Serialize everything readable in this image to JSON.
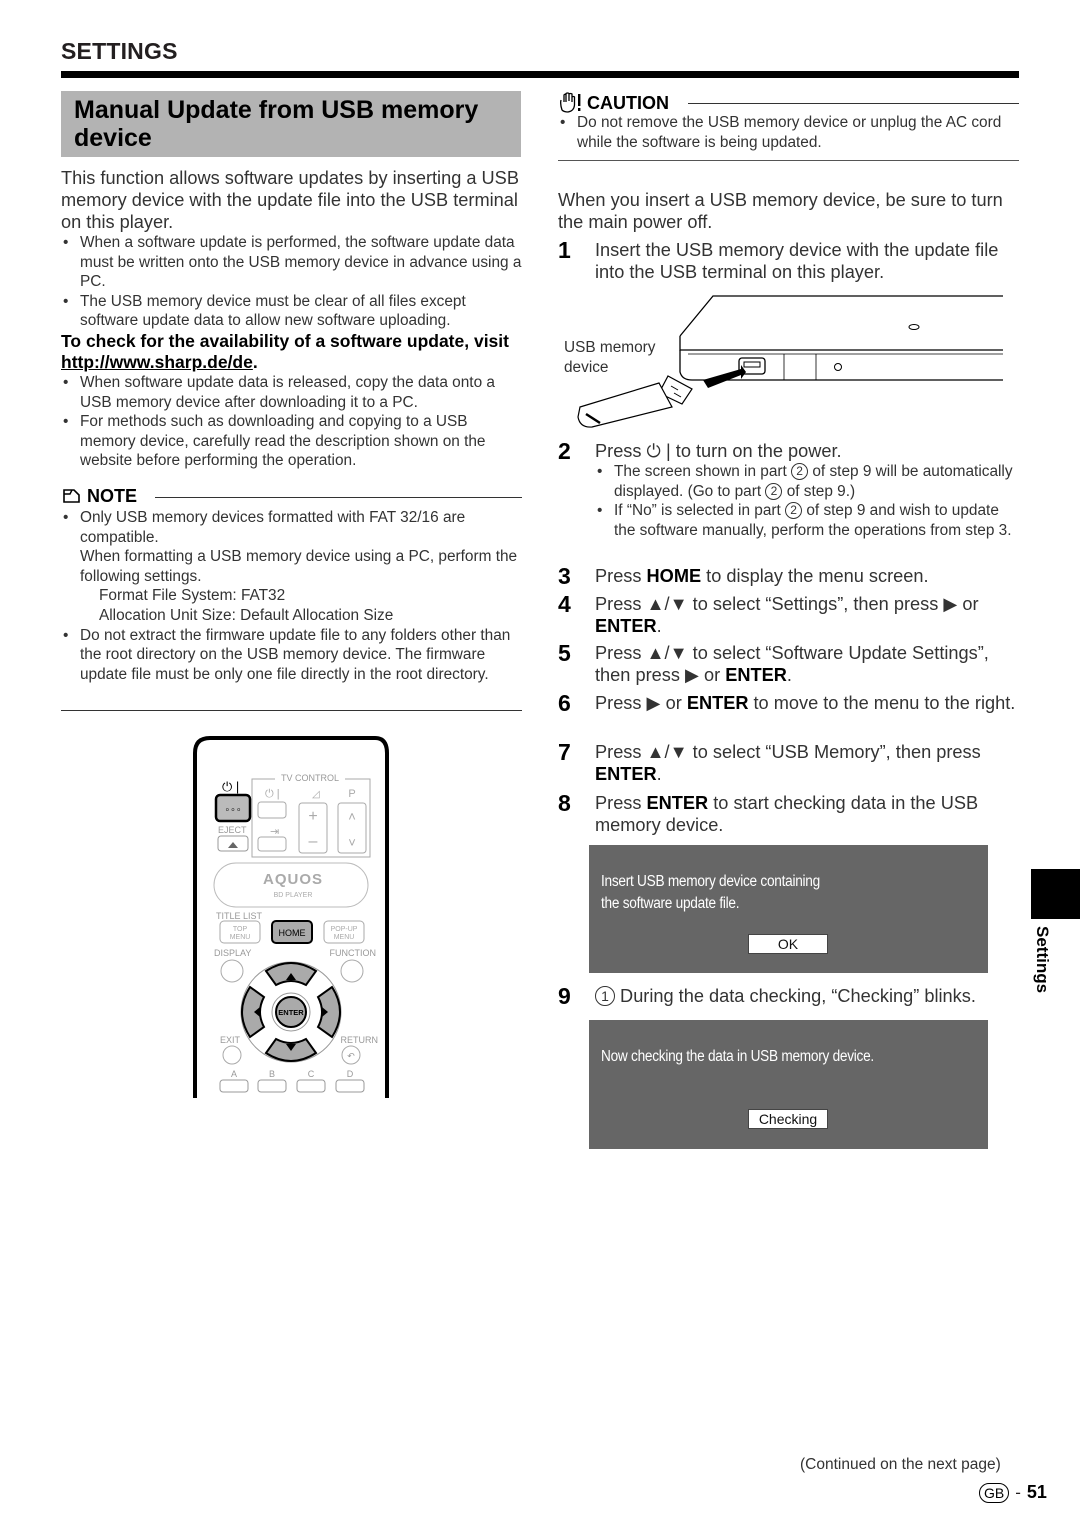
{
  "header": {
    "section_title": "SETTINGS",
    "page_heading": "Manual Update from USB memory device"
  },
  "left": {
    "intro": "This function allows software updates by inserting a USB memory device with the update file into the USB terminal on this player.",
    "bullets_1": [
      "When a software update is performed, the software update data must be written onto the USB memory device in advance using a PC.",
      "The USB memory device must be clear of all files except software update data to allow new software uploading."
    ],
    "check_text_prefix": "To check for the availability of a software update, visit ",
    "check_link": "http://www.sharp.de/de",
    "check_text_suffix": ".",
    "bullets_2": [
      "When software update data is released, copy the data onto a USB memory device after downloading it to a PC.",
      "For methods such as downloading and copying to a USB memory device, carefully read the description shown on the website before performing the operation."
    ],
    "note": {
      "label": "NOTE",
      "item1_line1": "Only USB memory devices formatted with FAT 32/16 are compatible.",
      "item1_line2": "When formatting a USB memory device using a PC, perform the following settings.",
      "item1_setting1": "Format File System: FAT32",
      "item1_setting2": "Allocation Unit Size: Default Allocation Size",
      "item2": "Do not extract the firmware update file to any folders other than the root directory on the USB memory device. The firmware update file must be only one file directly in the root directory."
    },
    "remote": {
      "power_label": "⏻ |",
      "tv_control": "TV CONTROL",
      "eject": "EJECT",
      "brand": "AQUOS",
      "brand_sub": "BD PLAYER",
      "title_list": "TITLE LIST",
      "top_menu": "TOP MENU",
      "home": "HOME",
      "popup_menu": "POP-UP MENU",
      "display": "DISPLAY",
      "function": "FUNCTION",
      "enter": "ENTER",
      "exit": "EXIT",
      "return": "RETURN",
      "color_keys": [
        "A",
        "B",
        "C",
        "D"
      ],
      "p_label": "P"
    }
  },
  "right": {
    "caution": {
      "label": "CAUTION",
      "item": "Do not remove the USB memory device or unplug the AC cord while the software is being updated."
    },
    "insert_note": "When you insert a USB memory device, be sure to turn the main power off.",
    "usb_figure_label": "USB memory device",
    "steps": [
      {
        "num": "1",
        "text": "Insert the USB memory device with the update file into the USB terminal on this player."
      },
      {
        "num": "2",
        "text_a": "Press ",
        "text_b": " | to turn on the power.",
        "sub": [
          {
            "a": "The screen shown in part ",
            "circ": "2",
            "b": " of step 9 will be automatically displayed. (Go to part ",
            "circ2": "2",
            "c": " of step 9.)"
          },
          {
            "a": "If “No” is selected in part ",
            "circ": "2",
            "b": " of step 9 and wish to update the software manually, perform the operations from step 3."
          }
        ]
      },
      {
        "num": "3",
        "a": "Press ",
        "bold": "HOME",
        "b": " to display the menu screen."
      },
      {
        "num": "4",
        "a": "Press ▲/▼ to select “Settings”, then press ▶ or ",
        "bold": "ENTER",
        "b": "."
      },
      {
        "num": "5",
        "a": "Press ▲/▼ to select “Software Update Settings”, then press ▶ or ",
        "bold": "ENTER",
        "b": "."
      },
      {
        "num": "6",
        "a": "Press ▶ or ",
        "bold": "ENTER",
        "b": " to move to the menu to the right."
      },
      {
        "num": "7",
        "a": "Press ▲/▼ to select “USB Memory”, then press ",
        "bold": "ENTER",
        "b": "."
      },
      {
        "num": "8",
        "a": "Press ",
        "bold": "ENTER",
        "b": " to start checking data in the USB memory device."
      },
      {
        "num": "9",
        "circ": "1",
        "text": " During the data checking, “Checking” blinks."
      }
    ],
    "osd_insert": {
      "line1": "Insert USB memory device containing",
      "line2": "the software update file.",
      "button": "OK"
    },
    "osd_checking": {
      "line1": "Now checking the data in USB memory device.",
      "button": "Checking"
    }
  },
  "side_tab": {
    "label": "Settings"
  },
  "footer": {
    "continued": "(Continued on the next page)",
    "region_badge": "GB",
    "separator": "-",
    "page_number": "51"
  }
}
